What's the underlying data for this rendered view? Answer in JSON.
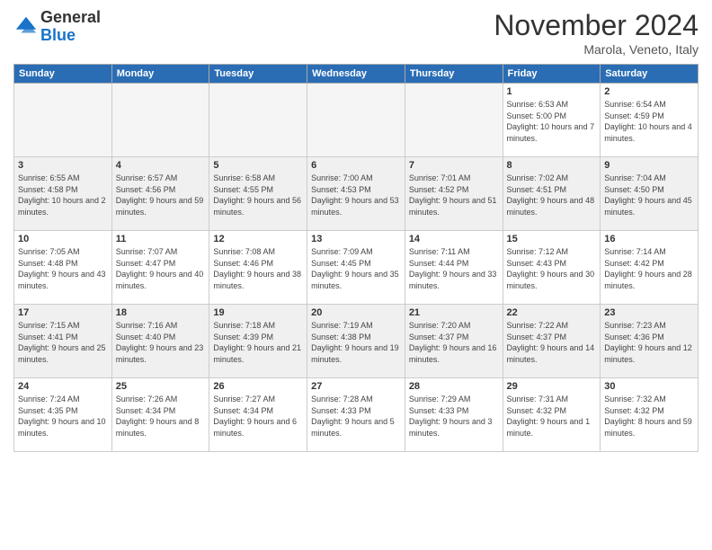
{
  "header": {
    "logo_line1": "General",
    "logo_line2": "Blue",
    "month": "November 2024",
    "location": "Marola, Veneto, Italy"
  },
  "weekdays": [
    "Sunday",
    "Monday",
    "Tuesday",
    "Wednesday",
    "Thursday",
    "Friday",
    "Saturday"
  ],
  "weeks": [
    [
      {
        "day": "",
        "info": ""
      },
      {
        "day": "",
        "info": ""
      },
      {
        "day": "",
        "info": ""
      },
      {
        "day": "",
        "info": ""
      },
      {
        "day": "",
        "info": ""
      },
      {
        "day": "1",
        "info": "Sunrise: 6:53 AM\nSunset: 5:00 PM\nDaylight: 10 hours and 7 minutes."
      },
      {
        "day": "2",
        "info": "Sunrise: 6:54 AM\nSunset: 4:59 PM\nDaylight: 10 hours and 4 minutes."
      }
    ],
    [
      {
        "day": "3",
        "info": "Sunrise: 6:55 AM\nSunset: 4:58 PM\nDaylight: 10 hours and 2 minutes."
      },
      {
        "day": "4",
        "info": "Sunrise: 6:57 AM\nSunset: 4:56 PM\nDaylight: 9 hours and 59 minutes."
      },
      {
        "day": "5",
        "info": "Sunrise: 6:58 AM\nSunset: 4:55 PM\nDaylight: 9 hours and 56 minutes."
      },
      {
        "day": "6",
        "info": "Sunrise: 7:00 AM\nSunset: 4:53 PM\nDaylight: 9 hours and 53 minutes."
      },
      {
        "day": "7",
        "info": "Sunrise: 7:01 AM\nSunset: 4:52 PM\nDaylight: 9 hours and 51 minutes."
      },
      {
        "day": "8",
        "info": "Sunrise: 7:02 AM\nSunset: 4:51 PM\nDaylight: 9 hours and 48 minutes."
      },
      {
        "day": "9",
        "info": "Sunrise: 7:04 AM\nSunset: 4:50 PM\nDaylight: 9 hours and 45 minutes."
      }
    ],
    [
      {
        "day": "10",
        "info": "Sunrise: 7:05 AM\nSunset: 4:48 PM\nDaylight: 9 hours and 43 minutes."
      },
      {
        "day": "11",
        "info": "Sunrise: 7:07 AM\nSunset: 4:47 PM\nDaylight: 9 hours and 40 minutes."
      },
      {
        "day": "12",
        "info": "Sunrise: 7:08 AM\nSunset: 4:46 PM\nDaylight: 9 hours and 38 minutes."
      },
      {
        "day": "13",
        "info": "Sunrise: 7:09 AM\nSunset: 4:45 PM\nDaylight: 9 hours and 35 minutes."
      },
      {
        "day": "14",
        "info": "Sunrise: 7:11 AM\nSunset: 4:44 PM\nDaylight: 9 hours and 33 minutes."
      },
      {
        "day": "15",
        "info": "Sunrise: 7:12 AM\nSunset: 4:43 PM\nDaylight: 9 hours and 30 minutes."
      },
      {
        "day": "16",
        "info": "Sunrise: 7:14 AM\nSunset: 4:42 PM\nDaylight: 9 hours and 28 minutes."
      }
    ],
    [
      {
        "day": "17",
        "info": "Sunrise: 7:15 AM\nSunset: 4:41 PM\nDaylight: 9 hours and 25 minutes."
      },
      {
        "day": "18",
        "info": "Sunrise: 7:16 AM\nSunset: 4:40 PM\nDaylight: 9 hours and 23 minutes."
      },
      {
        "day": "19",
        "info": "Sunrise: 7:18 AM\nSunset: 4:39 PM\nDaylight: 9 hours and 21 minutes."
      },
      {
        "day": "20",
        "info": "Sunrise: 7:19 AM\nSunset: 4:38 PM\nDaylight: 9 hours and 19 minutes."
      },
      {
        "day": "21",
        "info": "Sunrise: 7:20 AM\nSunset: 4:37 PM\nDaylight: 9 hours and 16 minutes."
      },
      {
        "day": "22",
        "info": "Sunrise: 7:22 AM\nSunset: 4:37 PM\nDaylight: 9 hours and 14 minutes."
      },
      {
        "day": "23",
        "info": "Sunrise: 7:23 AM\nSunset: 4:36 PM\nDaylight: 9 hours and 12 minutes."
      }
    ],
    [
      {
        "day": "24",
        "info": "Sunrise: 7:24 AM\nSunset: 4:35 PM\nDaylight: 9 hours and 10 minutes."
      },
      {
        "day": "25",
        "info": "Sunrise: 7:26 AM\nSunset: 4:34 PM\nDaylight: 9 hours and 8 minutes."
      },
      {
        "day": "26",
        "info": "Sunrise: 7:27 AM\nSunset: 4:34 PM\nDaylight: 9 hours and 6 minutes."
      },
      {
        "day": "27",
        "info": "Sunrise: 7:28 AM\nSunset: 4:33 PM\nDaylight: 9 hours and 5 minutes."
      },
      {
        "day": "28",
        "info": "Sunrise: 7:29 AM\nSunset: 4:33 PM\nDaylight: 9 hours and 3 minutes."
      },
      {
        "day": "29",
        "info": "Sunrise: 7:31 AM\nSunset: 4:32 PM\nDaylight: 9 hours and 1 minute."
      },
      {
        "day": "30",
        "info": "Sunrise: 7:32 AM\nSunset: 4:32 PM\nDaylight: 8 hours and 59 minutes."
      }
    ]
  ]
}
